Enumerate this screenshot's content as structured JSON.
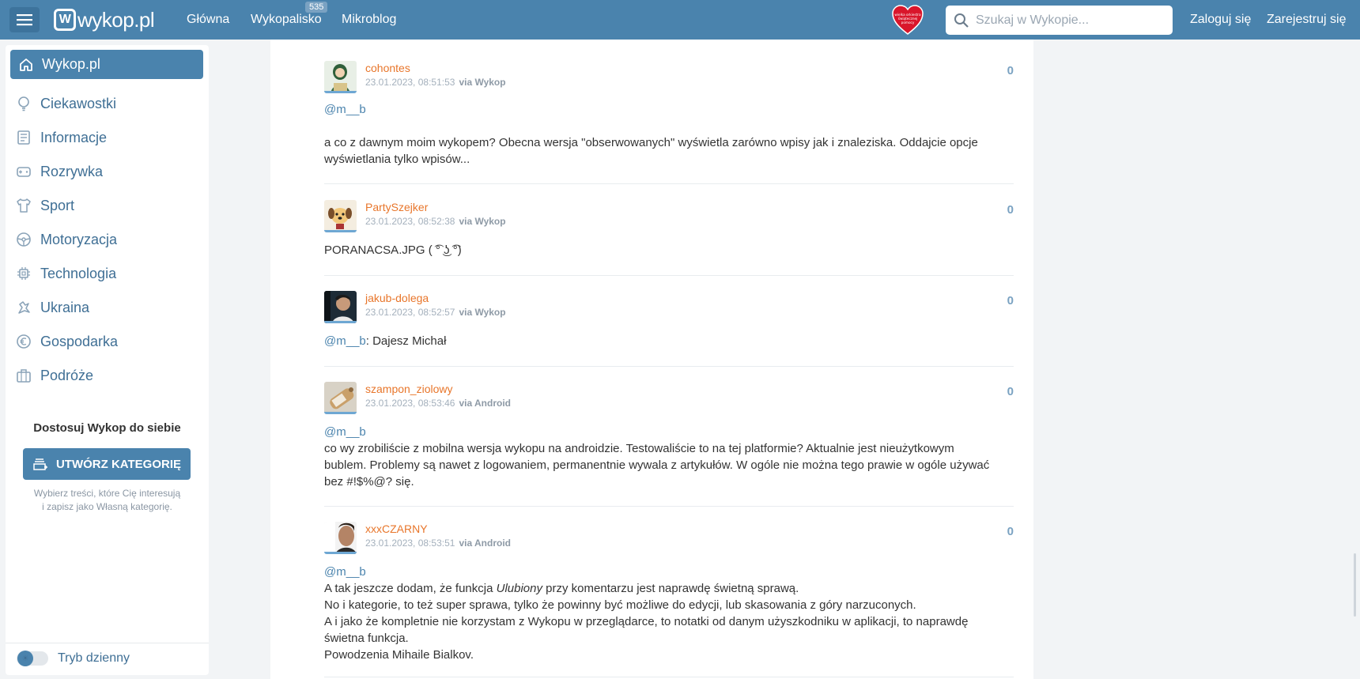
{
  "header": {
    "logo_text": "wykop.pl",
    "nav": [
      "Główna",
      "Wykopalisko",
      "Mikroblog"
    ],
    "wykopalisko_badge": "535",
    "heart_text": "wielka orkiestra świątecznej pomocy",
    "search_placeholder": "Szukaj w Wykopie...",
    "login": "Zaloguj się",
    "register": "Zarejestruj się"
  },
  "sidebar": {
    "home": "Wykop.pl",
    "items": [
      {
        "label": "Ciekawostki",
        "icon": "lightbulb-icon"
      },
      {
        "label": "Informacje",
        "icon": "newspaper-icon"
      },
      {
        "label": "Rozrywka",
        "icon": "gamepad-icon"
      },
      {
        "label": "Sport",
        "icon": "shirt-icon"
      },
      {
        "label": "Motoryzacja",
        "icon": "steering-wheel-icon"
      },
      {
        "label": "Technologia",
        "icon": "chip-icon"
      },
      {
        "label": "Ukraina",
        "icon": "ukraine-icon"
      },
      {
        "label": "Gospodarka",
        "icon": "euro-coin-icon"
      },
      {
        "label": "Podróże",
        "icon": "suitcase-icon"
      }
    ],
    "customize_title": "Dostosuj Wykop do siebie",
    "create_button": "UTWÓRZ KATEGORIĘ",
    "create_hint_1": "Wybierz treści, które Cię interesują",
    "create_hint_2": "i zapisz jako Własną kategorię.",
    "theme_label": "Tryb dzienny"
  },
  "comments": [
    {
      "user": "cohontes",
      "date": "23.01.2023, 08:51:53",
      "via": "via Wykop",
      "score": "0",
      "mention": "@m__b",
      "lines": [
        "a co z dawnym moim wykopem? Obecna wersja \"obserwowanych\" wyświetla zarówno wpisy jak i znaleziska. Oddajcie opcje",
        "wyświetlania tylko wpisów..."
      ]
    },
    {
      "user": "PartySzejker",
      "date": "23.01.2023, 08:52:38",
      "via": "via Wykop",
      "score": "0",
      "text": "PORANACSA.JPG ( ͡° ͜ʖ ͡°)"
    },
    {
      "user": "jakub-dolega",
      "date": "23.01.2023, 08:52:57",
      "via": "via Wykop",
      "score": "0",
      "mention": "@m__b",
      "text": ": Dajesz Michał"
    },
    {
      "user": "szampon_ziolowy",
      "date": "23.01.2023, 08:53:46",
      "via": "via Android",
      "score": "0",
      "mention": "@m__b",
      "lines": [
        "co wy zrobiliście z mobilna wersja wykopu na androidzie. Testowaliście to na tej platformie? Aktualnie jest nieużytkowym",
        "bublem. Problemy są nawet z logowaniem, permanentnie wywala z artykułów. W ogóle nie można tego prawie w ogóle używać",
        "bez #!$%@? się."
      ]
    },
    {
      "user": "xxxCZARNY",
      "date": "23.01.2023, 08:53:51",
      "via": "via Android",
      "score": "0",
      "mention": "@m__b",
      "line1_a": "A tak jeszcze dodam, że funkcja ",
      "line1_em": "Ulubiony",
      "line1_b": " przy komentarzu jest naprawdę świetną sprawą.",
      "lines": [
        "No i kategorie, to też super sprawa, tylko że powinny być możliwe do edycji, lub skasowania z góry narzuconych.",
        "A i jako że kompletnie nie korzystam z Wykopu w przeglądarce, to notatki od danym użyszkodniku w aplikacji, to naprawdę",
        "świetna funkcja.",
        "Powodzenia Mihaile Bialkov."
      ]
    }
  ]
}
